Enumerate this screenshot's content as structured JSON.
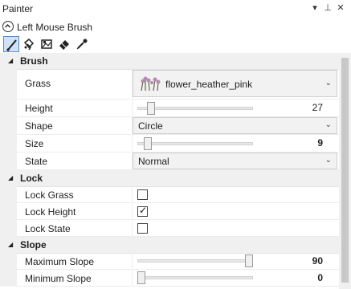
{
  "window": {
    "title": "Painter",
    "menu_glyph": "▾",
    "pin_glyph": "⊥",
    "close_glyph": "✕"
  },
  "mode": {
    "label": "Left Mouse Brush",
    "icon": "chevron-up-circle-icon"
  },
  "tools": [
    {
      "name": "brush-icon",
      "selected": true
    },
    {
      "name": "paint-bucket-icon",
      "selected": false
    },
    {
      "name": "image-stamp-icon",
      "selected": false
    },
    {
      "name": "eraser-icon",
      "selected": false
    },
    {
      "name": "eyedropper-icon",
      "selected": false
    }
  ],
  "categories": {
    "brush": "Brush",
    "lock": "Lock",
    "slope": "Slope"
  },
  "brush": {
    "grass_label": "Grass",
    "grass_value": "flower_heather_pink",
    "height_label": "Height",
    "height_value": "27",
    "height_fraction": 0.09,
    "shape_label": "Shape",
    "shape_value": "Circle",
    "size_label": "Size",
    "size_value": "9",
    "size_fraction": 0.06,
    "state_label": "State",
    "state_value": "Normal"
  },
  "lock": {
    "grass_label": "Lock Grass",
    "grass_checked": false,
    "height_label": "Lock Height",
    "height_checked": true,
    "state_label": "Lock State",
    "state_checked": false
  },
  "slope": {
    "max_label": "Maximum Slope",
    "max_value": "90",
    "max_fraction": 1.0,
    "min_label": "Minimum Slope",
    "min_value": "0",
    "min_fraction": 0.0
  },
  "colors": {
    "selection_border": "#4e8bd0",
    "selection_fill": "#cfe2f6",
    "category_bg": "#f0f0f0"
  }
}
